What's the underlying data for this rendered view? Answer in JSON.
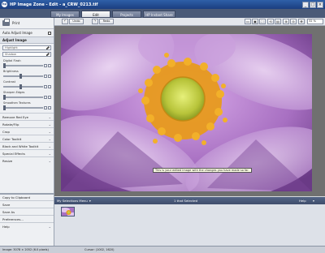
{
  "window": {
    "logo": "hp",
    "title": "HP Image Zone - Edit - a_CRW_0213.tif",
    "controls": [
      "_",
      "□",
      "×"
    ]
  },
  "tabs": [
    {
      "label": "My Images",
      "active": false
    },
    {
      "label": "Edit",
      "active": true
    },
    {
      "label": "Projects",
      "active": false
    },
    {
      "label": "HP Instant Share",
      "active": false
    }
  ],
  "left_panel": {
    "print_label": "Print",
    "auto_adjust_label": "Auto Adjust Image",
    "adjust_section": "Adjust Image",
    "highlight_placeholder": "Highlight",
    "shadow_placeholder": "Shadow",
    "sliders": [
      "Digital Flash",
      "Brightness",
      "Contrast",
      "Sharpen Edges",
      "Smoothen Textures"
    ],
    "menu": [
      "Remove Red Eye",
      "Rotate/Flip",
      "Crop",
      "Color Toolkit",
      "Black and White Toolkit",
      "Special Effects",
      "Resize"
    ],
    "actions": [
      "Copy to Clipboard",
      "Save",
      "Save As",
      "Preferences...",
      "Help"
    ]
  },
  "toolbar": {
    "undo_label": "Undo",
    "redo_label": "Redo",
    "zoom_value": "32 %"
  },
  "canvas": {
    "tooltip": "This is your edited image with the changes you have made so far."
  },
  "tray": {
    "title": "My Selections Menu",
    "count": "1 that Selected",
    "help": "Help"
  },
  "status": {
    "image_size": "Image: 3078 × 2052 (6.0 pixels)",
    "cursor": "Cursor: (1002, 1620)"
  },
  "colors": {
    "titlebar": "#1b3e80",
    "tab_strip": "#4a5a78",
    "canvas_bg": "#707070",
    "tray_bar": "#3e4d6c"
  }
}
